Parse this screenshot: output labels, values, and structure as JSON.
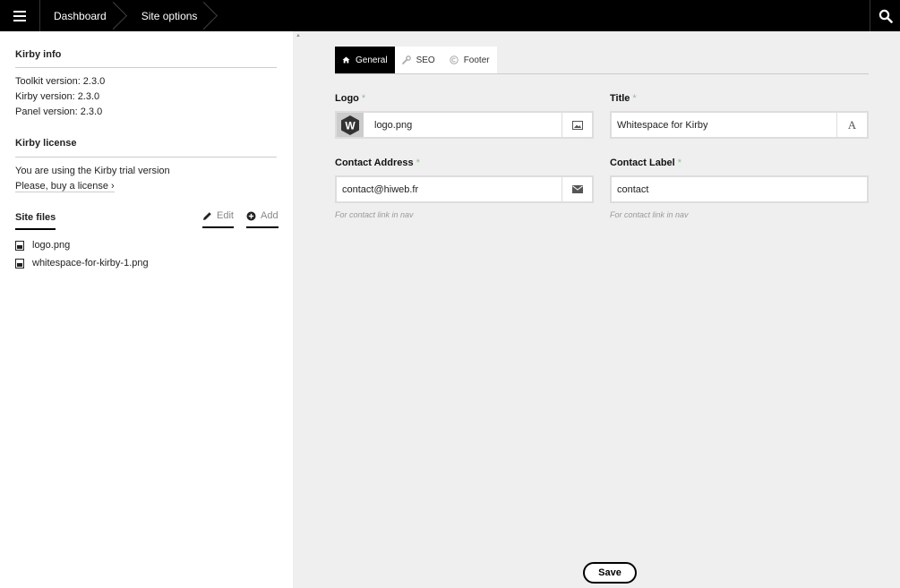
{
  "topbar": {
    "breadcrumbs": [
      "Dashboard",
      "Site options"
    ]
  },
  "sidebar": {
    "info": {
      "heading": "Kirby info",
      "lines": [
        "Toolkit version: 2.3.0",
        "Kirby version: 2.3.0",
        "Panel version: 2.3.0"
      ]
    },
    "license": {
      "heading": "Kirby license",
      "text": "You are using the Kirby trial version",
      "link": "Please, buy a license ›"
    },
    "files": {
      "heading": "Site files",
      "edit_label": "Edit",
      "add_label": "Add",
      "items": [
        "logo.png",
        "whitespace-for-kirby-1.png"
      ]
    }
  },
  "tabs": [
    {
      "label": "General",
      "active": true,
      "icon": "home-icon"
    },
    {
      "label": "SEO",
      "active": false,
      "icon": "wrench-icon"
    },
    {
      "label": "Footer",
      "active": false,
      "icon": "copyright-icon"
    }
  ],
  "form": {
    "logo": {
      "label": "Logo",
      "required": "*",
      "value": "logo.png",
      "thumb_letter": "W"
    },
    "title": {
      "label": "Title",
      "required": "*",
      "value": "Whitespace for Kirby",
      "icon_text": "A"
    },
    "contact_address": {
      "label": "Contact Address",
      "required": "*",
      "value": "contact@hiweb.fr",
      "help": "For contact link in nav"
    },
    "contact_label": {
      "label": "Contact Label",
      "required": "*",
      "value": "contact",
      "help": "For contact link in nav"
    }
  },
  "save_label": "Save",
  "colors": {
    "topbar": "#000000",
    "sidebar": "#ffffff",
    "main": "#efefef",
    "required": "#99bb99"
  }
}
